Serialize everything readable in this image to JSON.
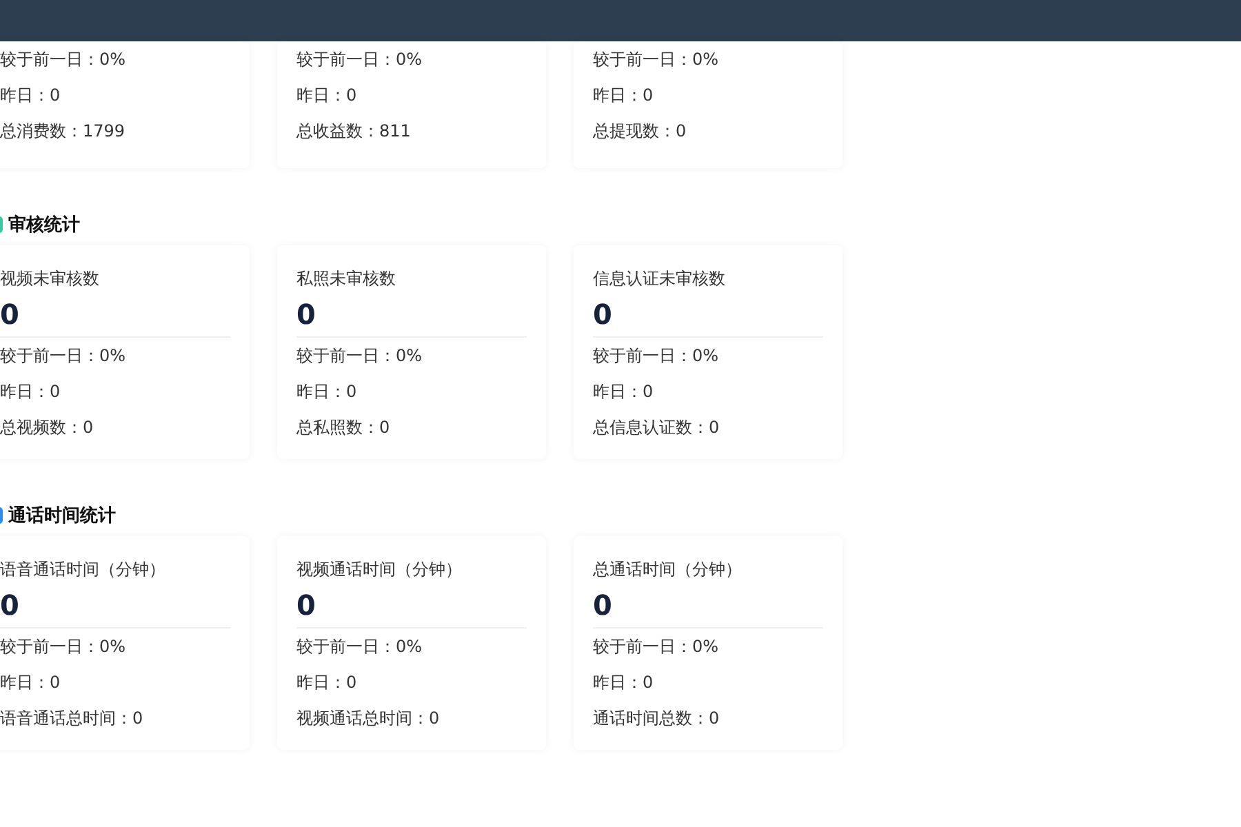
{
  "top_cards": [
    {
      "rows": [
        "较于前一日：0%",
        "昨日：0",
        "总消费数：1799"
      ]
    },
    {
      "rows": [
        "较于前一日：0%",
        "昨日：0",
        "总收益数：811"
      ]
    },
    {
      "rows": [
        "较于前一日：0%",
        "昨日：0",
        "总提现数：0"
      ]
    }
  ],
  "sections": [
    {
      "title": "审核统计",
      "color": "#3cc8a0",
      "cards": [
        {
          "label": "视频未审核数",
          "value": "0",
          "rows": [
            "较于前一日：0%",
            "昨日：0",
            "总视频数：0"
          ]
        },
        {
          "label": "私照未审核数",
          "value": "0",
          "rows": [
            "较于前一日：0%",
            "昨日：0",
            "总私照数：0"
          ]
        },
        {
          "label": "信息认证未审核数",
          "value": "0",
          "rows": [
            "较于前一日：0%",
            "昨日：0",
            "总信息认证数：0"
          ]
        }
      ]
    },
    {
      "title": "通话时间统计",
      "color": "#2d8cf0",
      "cards": [
        {
          "label": "语音通话时间（分钟）",
          "value": "0",
          "rows": [
            "较于前一日：0%",
            "昨日：0",
            "语音通话总时间：0"
          ]
        },
        {
          "label": "视频通话时间（分钟）",
          "value": "0",
          "rows": [
            "较于前一日：0%",
            "昨日：0",
            "视频通话总时间：0"
          ]
        },
        {
          "label": "总通话时间（分钟）",
          "value": "0",
          "rows": [
            "较于前一日：0%",
            "昨日：0",
            "通话时间总数：0"
          ]
        }
      ]
    }
  ]
}
